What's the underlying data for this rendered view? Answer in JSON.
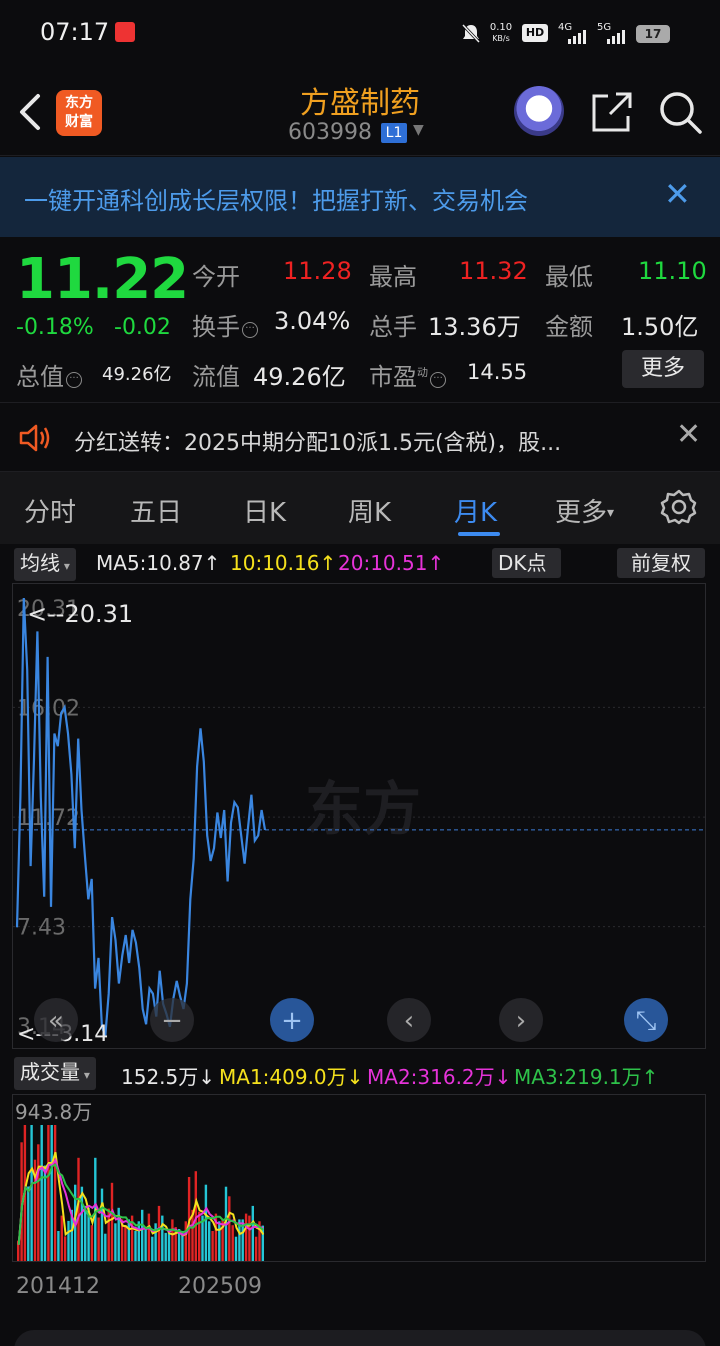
{
  "status_bar": {
    "time": "07:17",
    "net_speed": "0.10",
    "net_unit": "KB/s",
    "hd": "HD",
    "sig1": "4G",
    "sig2": "5G",
    "battery": "17"
  },
  "header": {
    "logo_text_1": "东方",
    "logo_text_2": "财富",
    "stock_name": "方盛制药",
    "stock_code": "603998",
    "level_badge": "L1"
  },
  "banner": {
    "text": "一键开通科创成长层权限！把握打新、交易机会",
    "close": "✕"
  },
  "quote": {
    "price": "11.22",
    "change_pct": "-0.18%",
    "change": "-0.02",
    "open_label": "今开",
    "open": "11.28",
    "high_label": "最高",
    "high": "11.32",
    "low_label": "最低",
    "low": "11.10",
    "turnover_label": "换手",
    "turnover": "3.04%",
    "volume_label": "总手",
    "volume": "13.36万",
    "amount_label": "金额",
    "amount": "1.50亿",
    "total_cap_label": "总值",
    "total_cap": "49.26亿",
    "float_cap_label": "流值",
    "float_cap": "49.26亿",
    "pe_label": "市盈",
    "pe_sup": "动",
    "pe": "14.55",
    "more_button": "更多"
  },
  "notice": {
    "text": "分红送转：2025中期分配10派1.5元(含税)，股...",
    "close": "✕"
  },
  "tabs": [
    "分时",
    "五日",
    "日K",
    "周K",
    "月K",
    "更多"
  ],
  "active_tab": "月K",
  "ma_bar": {
    "selector": "均线",
    "ma5": "MA5:10.87↑",
    "ma10": "10:10.16↑",
    "ma20": "20:10.51↑",
    "dk_button": "DK点",
    "adjust_button": "前复权"
  },
  "chart_data": {
    "type": "line",
    "y_ticks": [
      "20.31",
      "16.02",
      "11.72",
      "7.43",
      "3.14"
    ],
    "max_label": "<--20.31",
    "min_label": "<---3.14",
    "current_price": 11.22,
    "ylim": [
      3.14,
      20.31
    ],
    "values": [
      7.4,
      12.5,
      20.31,
      17.5,
      9.8,
      14.0,
      19.0,
      12.5,
      8.6,
      18.0,
      8.2,
      15.0,
      14.5,
      15.8,
      16.02,
      15.0,
      13.4,
      10.5,
      14.8,
      12.0,
      10.2,
      8.5,
      9.3,
      5.0,
      6.2,
      3.5,
      3.14,
      4.8,
      7.8,
      6.9,
      5.2,
      6.3,
      7.1,
      6.0,
      7.3,
      6.8,
      5.8,
      4.2,
      3.6,
      5.0,
      4.8,
      3.9,
      5.7,
      4.4,
      4.0,
      3.5,
      4.6,
      5.3,
      4.7,
      4.2,
      5.2,
      8.5,
      10.1,
      13.7,
      15.2,
      13.9,
      11.0,
      10.0,
      10.5,
      11.9,
      10.9,
      12.0,
      9.2,
      11.5,
      12.3,
      12.1,
      11.0,
      9.9,
      11.3,
      12.6,
      10.8,
      11.0,
      12.0,
      11.22
    ],
    "volume": {
      "label": "成交量",
      "current": "152.5万↓",
      "ma1": "MA1:409.0万↓",
      "ma2": "MA2:316.2万↓",
      "ma3": "MA3:219.1万↑",
      "max_label": "943.8万",
      "x_labels": [
        "201412",
        "202509"
      ]
    }
  },
  "colors": {
    "up": "#ee2222",
    "down": "#1fd93f",
    "accent": "#3d8bf0",
    "name": "#f0a020",
    "ma5": "#e8e8e8",
    "ma10": "#f5e11d",
    "ma20": "#e633d9",
    "ma3": "#2ec24a"
  }
}
